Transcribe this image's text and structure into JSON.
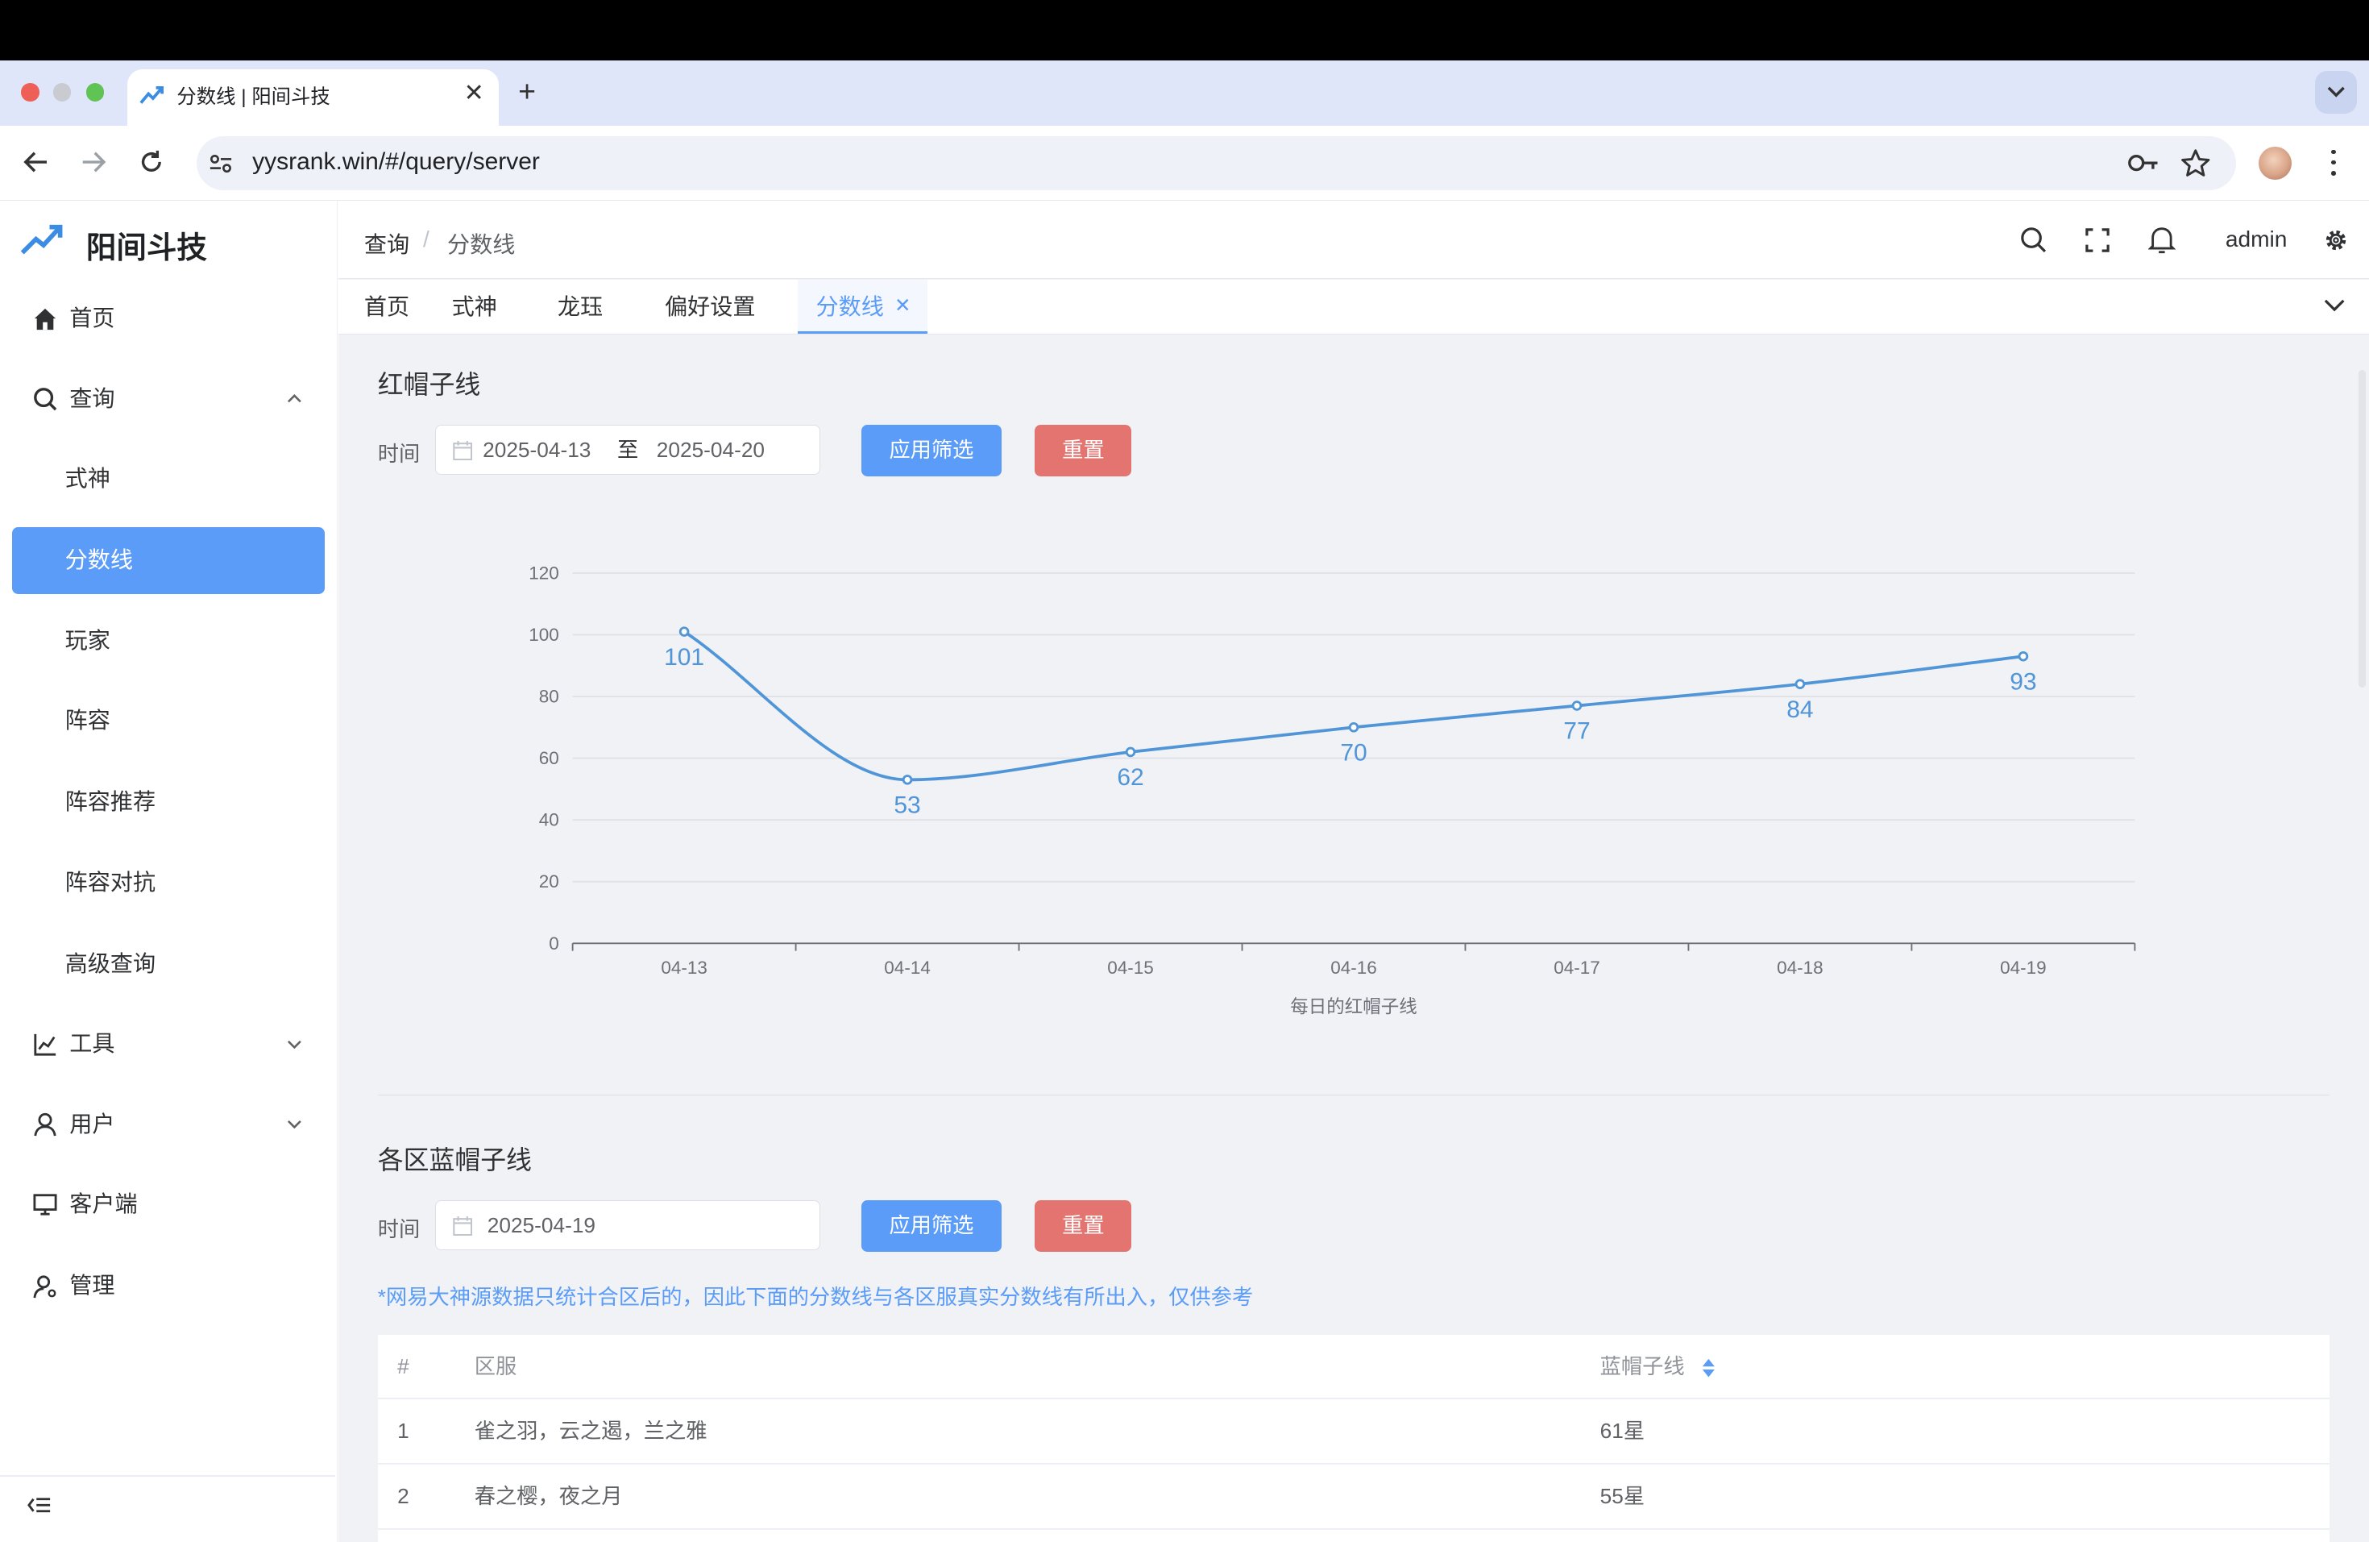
{
  "browser": {
    "tab_title": "分数线 | 阳间斗技",
    "new_tab_symbol": "+",
    "url": "yysrank.win/#/query/server"
  },
  "sidebar": {
    "app_name": "阳间斗技",
    "items": [
      {
        "label": "首页",
        "icon": "home-icon"
      },
      {
        "label": "查询",
        "icon": "search-icon",
        "expanded": true
      },
      {
        "label": "式神",
        "sub": true
      },
      {
        "label": "分数线",
        "sub": true,
        "active": true
      },
      {
        "label": "玩家",
        "sub": true
      },
      {
        "label": "阵容",
        "sub": true
      },
      {
        "label": "阵容推荐",
        "sub": true
      },
      {
        "label": "阵容对抗",
        "sub": true
      },
      {
        "label": "高级查询",
        "sub": true
      },
      {
        "label": "工具",
        "icon": "chart-line-icon",
        "expanded": false
      },
      {
        "label": "用户",
        "icon": "user-icon",
        "expanded": false
      },
      {
        "label": "客户端",
        "icon": "monitor-icon"
      },
      {
        "label": "管理",
        "icon": "admin-user-icon"
      }
    ]
  },
  "header": {
    "breadcrumb": [
      "查询",
      "分数线"
    ],
    "separator": "/",
    "user": "admin"
  },
  "tags": [
    "首页",
    "式神",
    "龙珏",
    "偏好设置",
    "分数线"
  ],
  "section_red": {
    "title": "红帽子线",
    "time_label": "时间",
    "start_date": "2025-04-13",
    "range_separator": "至",
    "end_date": "2025-04-20",
    "apply_label": "应用筛选",
    "reset_label": "重置"
  },
  "chart_data": {
    "type": "line",
    "x": [
      "04-13",
      "04-14",
      "04-15",
      "04-16",
      "04-17",
      "04-18",
      "04-19"
    ],
    "series": [
      {
        "values": [
          101,
          53,
          62,
          70,
          77,
          84,
          93
        ]
      }
    ],
    "xlabel": "每日的红帽子线",
    "ylim": [
      0,
      120
    ],
    "yticks": [
      0,
      20,
      40,
      60,
      80,
      100,
      120
    ],
    "grid": true,
    "color": "#4f95d8"
  },
  "section_blue": {
    "title": "各区蓝帽子线",
    "time_label": "时间",
    "date": "2025-04-19",
    "apply_label": "应用筛选",
    "reset_label": "重置",
    "note": "*网易大神源数据只统计合区后的，因此下面的分数线与各区服真实分数线有所出入，仅供参考",
    "table": {
      "headers": [
        "#",
        "区服",
        "蓝帽子线"
      ],
      "rows": [
        [
          "1",
          "雀之羽，云之遏，兰之雅",
          "61星"
        ],
        [
          "2",
          "春之樱，夜之月",
          "55星"
        ]
      ]
    }
  },
  "colors": {
    "accent": "#5a9cf8",
    "danger": "#e47470",
    "chart": "#4f95d8"
  }
}
